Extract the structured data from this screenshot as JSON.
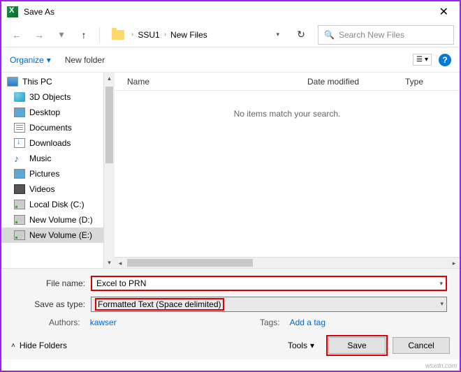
{
  "title": "Save As",
  "close_glyph": "✕",
  "nav": {
    "back": "←",
    "forward": "→",
    "recent": "▾",
    "up": "↑",
    "refresh": "↻"
  },
  "breadcrumb": {
    "sep": "›",
    "items": [
      "SSU1",
      "New Files"
    ],
    "dd": "▾"
  },
  "search": {
    "placeholder": "Search New Files",
    "icon": "🔍"
  },
  "toolbar": {
    "organize": "Organize",
    "org_dd": "▾",
    "new_folder": "New folder",
    "view_dd": "▾",
    "help": "?"
  },
  "columns": {
    "name": "Name",
    "date": "Date modified",
    "type": "Type"
  },
  "empty_msg": "No items match your search.",
  "sidebar": {
    "items": [
      {
        "label": "This PC",
        "ic": "ic-pc"
      },
      {
        "label": "3D Objects",
        "ic": "ic-3d"
      },
      {
        "label": "Desktop",
        "ic": "ic-desk"
      },
      {
        "label": "Documents",
        "ic": "ic-doc"
      },
      {
        "label": "Downloads",
        "ic": "ic-dl"
      },
      {
        "label": "Music",
        "ic": "ic-music",
        "glyph": "♪"
      },
      {
        "label": "Pictures",
        "ic": "ic-pic"
      },
      {
        "label": "Videos",
        "ic": "ic-vid"
      },
      {
        "label": "Local Disk (C:)",
        "ic": "ic-drive"
      },
      {
        "label": "New Volume (D:)",
        "ic": "ic-drive"
      },
      {
        "label": "New Volume (E:)",
        "ic": "ic-drive"
      }
    ]
  },
  "filename": {
    "label": "File name:",
    "value": "Excel to PRN"
  },
  "savetype": {
    "label": "Save as type:",
    "value": "Formatted Text (Space delimited)"
  },
  "meta": {
    "authors_lbl": "Authors:",
    "authors_val": "kawser",
    "tags_lbl": "Tags:",
    "tags_val": "Add a tag"
  },
  "footer": {
    "hide": "Hide Folders",
    "tools": "Tools",
    "tools_dd": "▾",
    "save": "Save",
    "cancel": "Cancel",
    "chev": "˄"
  },
  "watermark": "wsxdn.com"
}
